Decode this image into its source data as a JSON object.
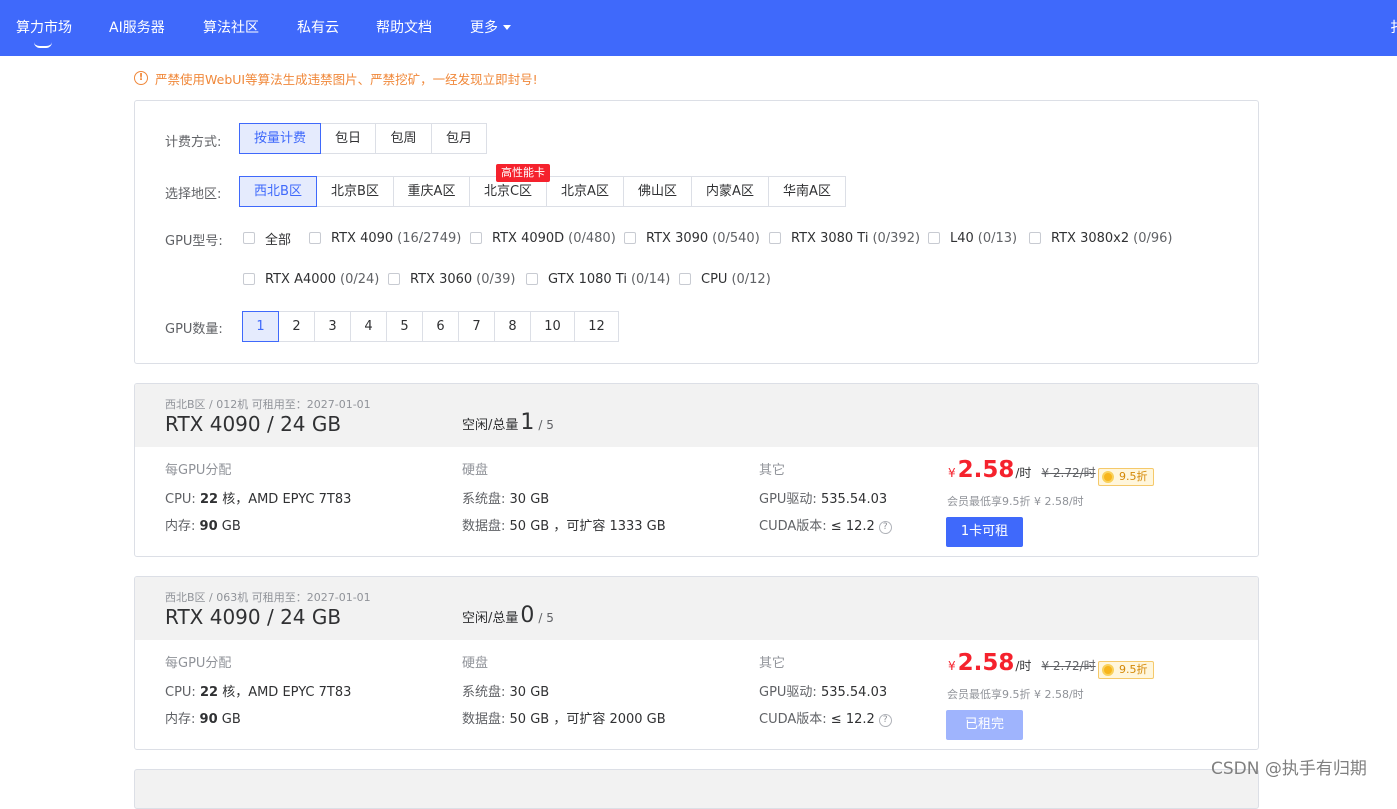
{
  "nav": {
    "items": [
      "算力市场",
      "AI服务器",
      "算法社区",
      "私有云",
      "帮助文档",
      "更多"
    ],
    "edge_char": "扌"
  },
  "warning": "严禁使用WebUI等算法生成违禁图片、严禁挖矿，一经发现立即封号!",
  "filters": {
    "billing": {
      "label": "计费方式:",
      "options": [
        "按量计费",
        "包日",
        "包周",
        "包月"
      ],
      "selected": "按量计费"
    },
    "region": {
      "label": "选择地区:",
      "options": [
        "西北B区",
        "北京B区",
        "重庆A区",
        "北京C区",
        "北京A区",
        "佛山区",
        "内蒙A区",
        "华南A区"
      ],
      "selected": "西北B区",
      "badge": "高性能卡"
    },
    "gpu_model": {
      "label": "GPU型号:",
      "options": [
        {
          "name": "全部",
          "count": ""
        },
        {
          "name": "RTX 4090",
          "count": "(16/2749)"
        },
        {
          "name": "RTX 4090D",
          "count": "(0/480)"
        },
        {
          "name": "RTX 3090",
          "count": "(0/540)"
        },
        {
          "name": "RTX 3080 Ti",
          "count": "(0/392)"
        },
        {
          "name": "L40",
          "count": "(0/13)"
        },
        {
          "name": "RTX 3080x2",
          "count": "(0/96)"
        },
        {
          "name": "RTX A4000",
          "count": "(0/24)"
        },
        {
          "name": "RTX 3060",
          "count": "(0/39)"
        },
        {
          "name": "GTX 1080 Ti",
          "count": "(0/14)"
        },
        {
          "name": "CPU",
          "count": "(0/12)"
        }
      ]
    },
    "gpu_count": {
      "label": "GPU数量:",
      "options": [
        "1",
        "2",
        "3",
        "4",
        "5",
        "6",
        "7",
        "8",
        "10",
        "12"
      ],
      "selected": "1"
    }
  },
  "cards": [
    {
      "location": "西北B区 / 012机   可租用至：2027-01-01",
      "title": "RTX 4090 / 24 GB",
      "idle_label": "空闲/总量",
      "idle": "1",
      "total": "/ 5",
      "per_gpu_label": "每GPU分配",
      "cpu_label": "CPU:",
      "cpu_cores": "22",
      "cpu_rest": "核，AMD EPYC 7T83",
      "mem_label": "内存:",
      "mem_val": "90",
      "mem_unit": "GB",
      "disk_label": "硬盘",
      "sys_disk_label": "系统盘:",
      "sys_disk": "30 GB",
      "data_disk_label": "数据盘:",
      "data_disk": "50 GB ，可扩容 1333 GB",
      "other_label": "其它",
      "driver_label": "GPU驱动:",
      "driver": "535.54.03",
      "cuda_label": "CUDA版本:",
      "cuda": "≤ 12.2",
      "yen": "¥",
      "price": "2.58",
      "unit": "/时",
      "orig_price": "¥ 2.72/时",
      "discount": "9.5折",
      "member": "会员最低享9.5折 ¥ 2.58/时",
      "button": "1卡可租",
      "button_disabled": false
    },
    {
      "location": "西北B区 / 063机   可租用至：2027-01-01",
      "title": "RTX 4090 / 24 GB",
      "idle_label": "空闲/总量",
      "idle": "0",
      "total": "/ 5",
      "per_gpu_label": "每GPU分配",
      "cpu_label": "CPU:",
      "cpu_cores": "22",
      "cpu_rest": "核，AMD EPYC 7T83",
      "mem_label": "内存:",
      "mem_val": "90",
      "mem_unit": "GB",
      "disk_label": "硬盘",
      "sys_disk_label": "系统盘:",
      "sys_disk": "30 GB",
      "data_disk_label": "数据盘:",
      "data_disk": "50 GB ，可扩容 2000 GB",
      "other_label": "其它",
      "driver_label": "GPU驱动:",
      "driver": "535.54.03",
      "cuda_label": "CUDA版本:",
      "cuda": "≤ 12.2",
      "yen": "¥",
      "price": "2.58",
      "unit": "/时",
      "orig_price": "¥ 2.72/时",
      "discount": "9.5折",
      "member": "会员最低享9.5折 ¥ 2.58/时",
      "button": "已租完",
      "button_disabled": true
    }
  ],
  "watermark": "CSDN @执手有归期",
  "colors": {
    "brand": "#3f69fb",
    "price": "#f5222d",
    "warning": "#f0883a"
  }
}
